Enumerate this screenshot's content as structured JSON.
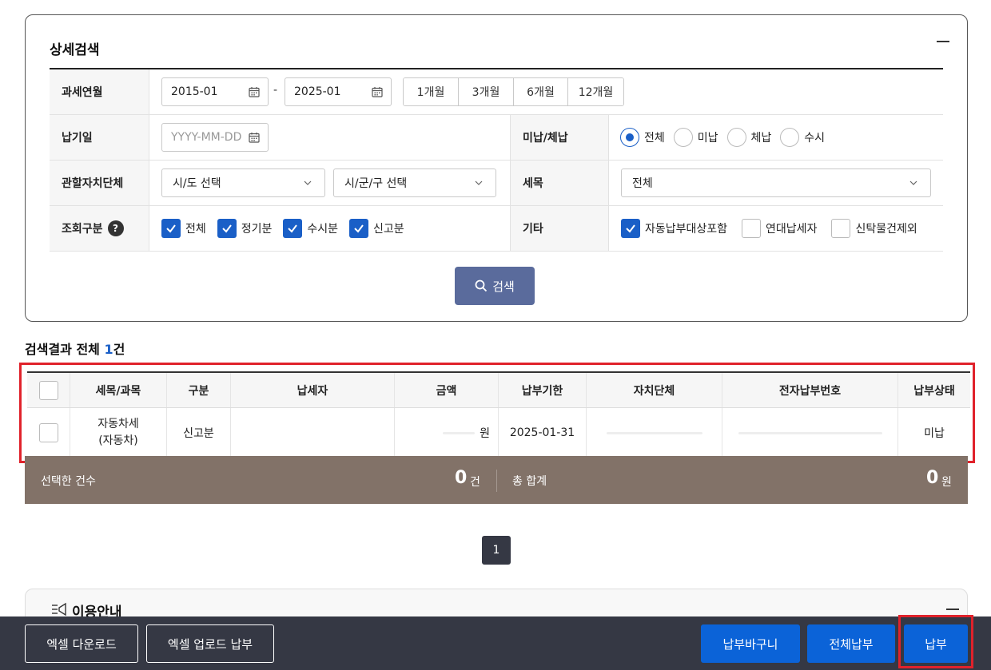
{
  "search_panel": {
    "title": "상세검색",
    "tax_period": {
      "label": "과세연월",
      "start": "2015-01",
      "separator": "-",
      "end": "2025-01",
      "ranges": [
        "1개월",
        "3개월",
        "6개월",
        "12개월"
      ]
    },
    "due_date": {
      "label": "납기일",
      "placeholder": "YYYY-MM-DD"
    },
    "unpaid_status": {
      "label": "미납/체납",
      "options": [
        "전체",
        "미납",
        "체납",
        "수시"
      ],
      "selected": "전체"
    },
    "local_gov": {
      "label": "관할자치단체",
      "province": "시/도 선택",
      "city": "시/군/구 선택"
    },
    "tax_item": {
      "label": "세목",
      "value": "전체"
    },
    "query_type": {
      "label": "조회구분",
      "help": "?",
      "options": [
        "전체",
        "정기분",
        "수시분",
        "신고분"
      ]
    },
    "etc": {
      "label": "기타",
      "options": [
        {
          "label": "자동납부대상포함",
          "checked": true
        },
        {
          "label": "연대납세자",
          "checked": false
        },
        {
          "label": "신탁물건제외",
          "checked": false
        }
      ]
    },
    "search_button": "검색"
  },
  "results": {
    "title_prefix": "검색결과 전체 ",
    "count": "1",
    "title_suffix": "건",
    "headers": [
      "세목/과목",
      "구분",
      "납세자",
      "금액",
      "납부기한",
      "자치단체",
      "전자납부번호",
      "납부상태"
    ],
    "rows": [
      {
        "tax_item": "자동차세",
        "tax_sub": "(자동차)",
        "type": "신고분",
        "amount_unit": "원",
        "due": "2025-01-31",
        "status": "미납"
      }
    ]
  },
  "summary": {
    "selected_label": "선택한 건수",
    "selected_value": "0",
    "selected_unit": "건",
    "total_label": "총 합계",
    "total_value": "0",
    "total_unit": "원"
  },
  "pagination": {
    "current": "1"
  },
  "guide": {
    "title": "이용안내"
  },
  "bottom_bar": {
    "excel_download": "엑셀 다운로드",
    "excel_upload": "엑셀 업로드 납부",
    "basket": "납부바구니",
    "pay_all": "전체납부",
    "pay": "납부"
  },
  "colors": {
    "accent": "#1a5fc7",
    "search_button": "#5a6b9c",
    "summary_bar": "#827268",
    "bottom_bar": "#353844",
    "primary_button": "#0b63d8",
    "highlight": "#e0222b"
  }
}
